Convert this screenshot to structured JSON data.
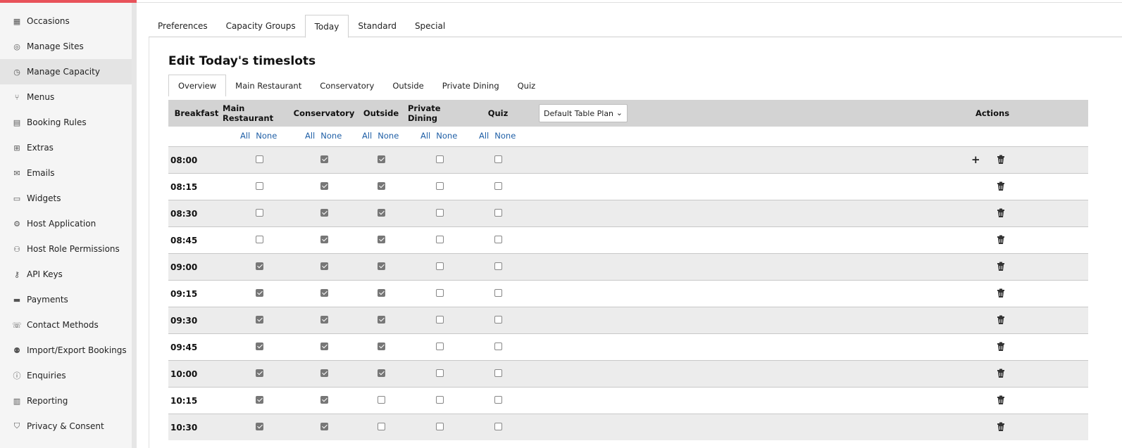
{
  "sidebar": {
    "items": [
      {
        "label": "Occasions",
        "icon": "calendar-icon",
        "glyph": "▦"
      },
      {
        "label": "Manage Sites",
        "icon": "location-pin-icon",
        "glyph": "◎"
      },
      {
        "label": "Manage Capacity",
        "icon": "clock-icon",
        "glyph": "◷",
        "active": true
      },
      {
        "label": "Menus",
        "icon": "cutlery-icon",
        "glyph": "⑂"
      },
      {
        "label": "Booking Rules",
        "icon": "document-icon",
        "glyph": "▤"
      },
      {
        "label": "Extras",
        "icon": "cart-icon",
        "glyph": "⊞"
      },
      {
        "label": "Emails",
        "icon": "mail-icon",
        "glyph": "✉"
      },
      {
        "label": "Widgets",
        "icon": "window-icon",
        "glyph": "▭"
      },
      {
        "label": "Host Application",
        "icon": "gears-icon",
        "glyph": "⚙"
      },
      {
        "label": "Host Role Permissions",
        "icon": "users-icon",
        "glyph": "⚇"
      },
      {
        "label": "API Keys",
        "icon": "key-icon",
        "glyph": "⚷"
      },
      {
        "label": "Payments",
        "icon": "card-icon",
        "glyph": "▬"
      },
      {
        "label": "Contact Methods",
        "icon": "phone-icon",
        "glyph": "☏"
      },
      {
        "label": "Import/Export Bookings",
        "icon": "user-transfer-icon",
        "glyph": "⚉"
      },
      {
        "label": "Enquiries",
        "icon": "info-icon",
        "glyph": "ⓘ"
      },
      {
        "label": "Reporting",
        "icon": "chart-icon",
        "glyph": "▥"
      },
      {
        "label": "Privacy & Consent",
        "icon": "shield-icon",
        "glyph": "⛉"
      }
    ]
  },
  "tabs": [
    "Preferences",
    "Capacity Groups",
    "Today",
    "Standard",
    "Special"
  ],
  "active_tab": "Today",
  "page_title": "Edit Today's timeslots",
  "subtabs": [
    "Overview",
    "Main Restaurant",
    "Conservatory",
    "Outside",
    "Private Dining",
    "Quiz"
  ],
  "active_subtab": "Overview",
  "grid": {
    "period_label": "Breakfast",
    "columns": [
      "Main Restaurant",
      "Conservatory",
      "Outside",
      "Private Dining",
      "Quiz"
    ],
    "table_plan_select": "Default Table Plan",
    "actions_label": "Actions",
    "all_label": "All",
    "none_label": "None",
    "rows": [
      {
        "time": "08:00",
        "checks": [
          false,
          true,
          true,
          false,
          false
        ],
        "plus": true
      },
      {
        "time": "08:15",
        "checks": [
          false,
          true,
          true,
          false,
          false
        ]
      },
      {
        "time": "08:30",
        "checks": [
          false,
          true,
          true,
          false,
          false
        ]
      },
      {
        "time": "08:45",
        "checks": [
          false,
          true,
          true,
          false,
          false
        ]
      },
      {
        "time": "09:00",
        "checks": [
          true,
          true,
          true,
          false,
          false
        ]
      },
      {
        "time": "09:15",
        "checks": [
          true,
          true,
          true,
          false,
          false
        ]
      },
      {
        "time": "09:30",
        "checks": [
          true,
          true,
          true,
          false,
          false
        ]
      },
      {
        "time": "09:45",
        "checks": [
          true,
          true,
          true,
          false,
          false
        ]
      },
      {
        "time": "10:00",
        "checks": [
          true,
          true,
          true,
          false,
          false
        ]
      },
      {
        "time": "10:15",
        "checks": [
          true,
          true,
          false,
          false,
          false
        ]
      },
      {
        "time": "10:30",
        "checks": [
          true,
          true,
          false,
          false,
          false
        ]
      }
    ]
  },
  "colors": {
    "accent": "#e8525a",
    "link": "#1f5fa6",
    "header_bg": "#d3d3d3",
    "row_shade": "#ececec"
  }
}
